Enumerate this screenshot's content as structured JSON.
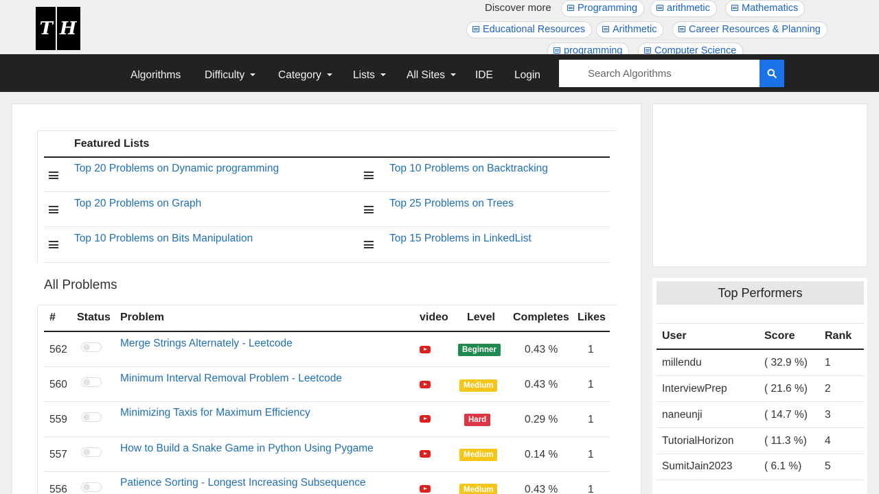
{
  "header": {
    "logo_left": "T",
    "logo_right": "H",
    "discover_label": "Discover more",
    "chips": [
      "Programming",
      "arithmetic",
      "Mathematics",
      "Educational Resources",
      "Arithmetic",
      "Career Resources & Planning",
      "programming",
      "Computer Science"
    ]
  },
  "nav": {
    "items": [
      "Algorithms",
      "Difficulty",
      "Category",
      "Lists",
      "All Sites",
      "IDE",
      "Login"
    ],
    "search_placeholder": "Search Algorithms"
  },
  "featured": {
    "heading": "Featured Lists",
    "links": [
      "Top 20 Problems on Dynamic programming",
      "Top 10 Problems on Backtracking",
      "Top 20 Problems on Graph",
      "Top 25 Problems on Trees",
      "Top 10 Problems on Bits Manipulation",
      "Top 15 Problems in LinkedList"
    ]
  },
  "problems": {
    "heading": "All Problems",
    "columns": [
      "#",
      "Status",
      "Problem",
      "video",
      "Level",
      "Completes",
      "Likes"
    ],
    "rows": [
      {
        "id": "562",
        "title": "Merge Strings Alternately - Leetcode",
        "level": "Beginner",
        "completes": "0.43 %",
        "likes": "1"
      },
      {
        "id": "560",
        "title": "Minimum Interval Removal Problem - Leetcode",
        "level": "Medium",
        "completes": "0.43 %",
        "likes": "1"
      },
      {
        "id": "559",
        "title": "Minimizing Taxis for Maximum Efficiency",
        "level": "Hard",
        "completes": "0.29 %",
        "likes": "1"
      },
      {
        "id": "557",
        "title": "How to Build a Snake Game in Python Using Pygame",
        "level": "Medium",
        "completes": "0.14 %",
        "likes": "1"
      },
      {
        "id": "556",
        "title": "Patience Sorting - Longest Increasing Subsequence",
        "level": "Medium",
        "completes": "0.43 %",
        "likes": "1"
      }
    ],
    "level_colors": {
      "Beginner": "#1e8a4f",
      "Medium": "#f5c518",
      "Hard": "#dc3545"
    }
  },
  "top_performers": {
    "heading": "Top Performers",
    "columns": [
      "User",
      "Score",
      "Rank"
    ],
    "rows": [
      {
        "user": "millendu",
        "score": "( 32.9 %)",
        "rank": "1"
      },
      {
        "user": "InterviewPrep",
        "score": "( 21.6 %)",
        "rank": "2"
      },
      {
        "user": "naneunji",
        "score": "( 14.7 %)",
        "rank": "3"
      },
      {
        "user": "TutorialHorizon",
        "score": "( 11.3 %)",
        "rank": "4"
      },
      {
        "user": "SumitJain2023",
        "score": "( 6.1 %)",
        "rank": "5"
      }
    ]
  }
}
